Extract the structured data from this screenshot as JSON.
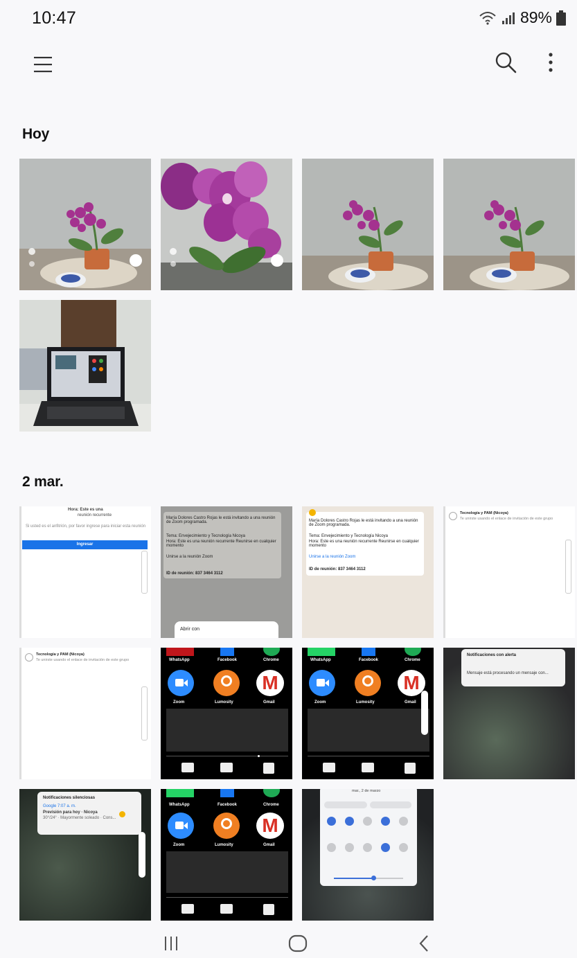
{
  "status": {
    "time": "10:47",
    "battery": "89%",
    "icons": [
      "wifi-icon",
      "signal-icon",
      "battery-icon"
    ]
  },
  "toolbar": {
    "icons": [
      "menu-icon",
      "search-icon",
      "more-vertical-icon"
    ]
  },
  "sections": [
    {
      "title": "Hoy"
    },
    {
      "title": "2 mar."
    }
  ],
  "thumbs": {
    "s2_1": {
      "line1": "Hora: Este es una",
      "line2": "reunión recurrente",
      "line3": "Si usted es el anfitrión, por favor ingrese para iniciar esta reunión",
      "button": "Ingresar"
    },
    "s2_2": {
      "line1": "María Dolores Castro Rojas le está invitando a una reunión de Zoom programada.",
      "line2": "Tema: Envejecimiento y Tecnología Nicoya",
      "line3": "Hora: Este es una reunión recurrente Reunirse en cualquier momento",
      "line4": "Unirse a la reunión Zoom",
      "line5": "ID de reunión: 837 3464 3112",
      "menu": "Abrir con"
    },
    "s2_4": {
      "title": "Tecnología y PAM (Nicoya)",
      "sub": "Te unirste usando el enlace de invitación de este grupo"
    },
    "apps": {
      "a1": "WhatsApp",
      "a2": "Facebook",
      "a3": "Chrome",
      "a4": "Zoom",
      "a5": "Lumosity",
      "a6": "Gmail"
    },
    "notif1": {
      "title": "Notificaciones con alerta",
      "body": "Mensaje está procesando un mensaje con..."
    },
    "notif2": {
      "title": "Notificaciones silenciosas",
      "app": "Google 7:07 a. m.",
      "body": "Previsión para hoy · Nicoya",
      "detail": "30°/24° · Mayormente soleado · Cons..."
    },
    "quick": {
      "date": "mar., 2 de marzo"
    }
  },
  "nav": {
    "icons": [
      "recent-apps-icon",
      "home-icon",
      "back-icon"
    ]
  }
}
